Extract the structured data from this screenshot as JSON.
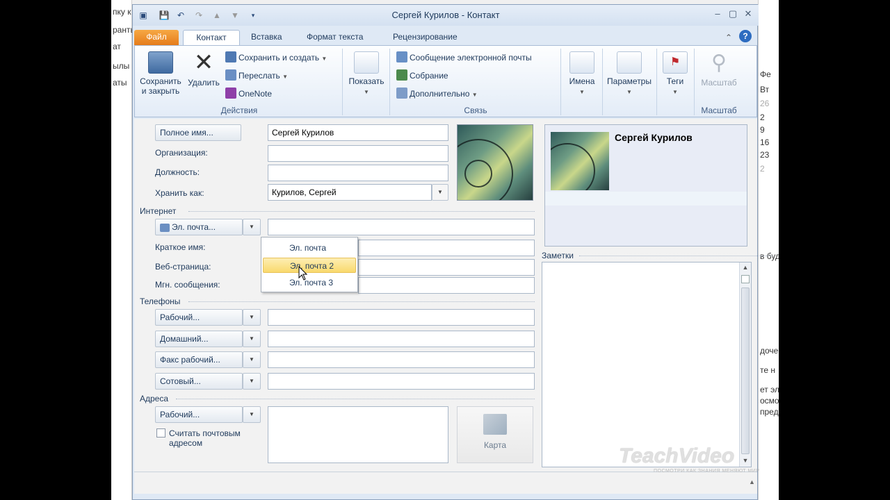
{
  "window": {
    "title": "Сергей Курилов - Контакт"
  },
  "tabs": [
    "Файл",
    "Контакт",
    "Вставка",
    "Формат текста",
    "Рецензирование"
  ],
  "ribbon": {
    "save_close": "Сохранить и закрыть",
    "delete": "Удалить",
    "save_create": "Сохранить и создать",
    "forward": "Переслать",
    "onenote": "OneNote",
    "group_actions": "Действия",
    "show": "Показать",
    "email_msg": "Сообщение электронной почты",
    "meeting": "Собрание",
    "more": "Дополнительно",
    "group_comm": "Связь",
    "names": "Имена",
    "params": "Параметры",
    "tags": "Теги",
    "zoom": "Масштаб",
    "group_zoom": "Масштаб"
  },
  "form": {
    "full_name_btn": "Полное имя...",
    "full_name_val": "Сергей Курилов",
    "company_lbl": "Организация:",
    "jobtitle_lbl": "Должность:",
    "fileas_lbl": "Хранить как:",
    "fileas_val": "Курилов, Сергей",
    "internet_sect": "Интернет",
    "email_btn": "Эл. почта...",
    "display_lbl": "Краткое имя:",
    "web_lbl": "Веб-страница:",
    "im_lbl": "Мгн. сообщения:",
    "phones_sect": "Телефоны",
    "phone1": "Рабочий...",
    "phone2": "Домашний...",
    "phone3": "Факс рабочий...",
    "phone4": "Сотовый...",
    "addr_sect": "Адреса",
    "addr_btn": "Рабочий...",
    "mailing_chk": "Считать почтовым адресом",
    "map": "Карта",
    "notes_lbl": "Заметки",
    "card_name": "Сергей Курилов"
  },
  "email_menu": [
    "Эл. почта",
    "Эл. почта 2",
    "Эл. почта 3"
  ],
  "watermark": {
    "brand": "TeachVideo",
    "tagline": "ПОСМОТРИ КАК ЗНАНИЯ МЕНЯЮТ МИР"
  },
  "background": {
    "left_fragments": [
      "пку к",
      "ранты",
      "ат",
      "ылы",
      "аты"
    ],
    "right_fragments": [
      "Фе",
      "Вт",
      "26",
      "2",
      "9",
      "16",
      "23",
      "2",
      "в буд",
      "дочем",
      "те н",
      "ет эл",
      "осмо",
      "пред"
    ]
  }
}
